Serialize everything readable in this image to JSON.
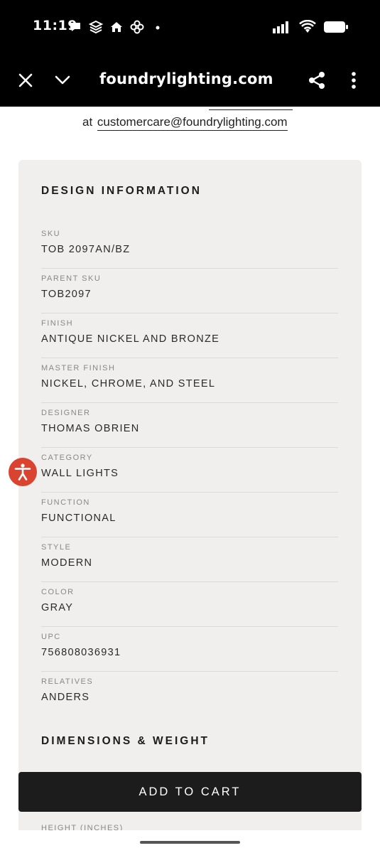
{
  "status_bar": {
    "time": "11:19",
    "left_icons": [
      "chat-bubble-icon",
      "layers-icon",
      "home-icon",
      "pinwheel-icon",
      "dot-icon"
    ],
    "right_icons": [
      "signal-icon",
      "wifi-icon",
      "battery-icon"
    ]
  },
  "browser": {
    "url": "foundrylighting.com",
    "icons": [
      "close-icon",
      "chevron-down-icon",
      "share-icon",
      "more-vert-icon"
    ]
  },
  "contact": {
    "prefix": "at",
    "email": "customercare@foundrylighting.com"
  },
  "design_info": {
    "title": "DESIGN INFORMATION",
    "items": [
      {
        "label": "SKU",
        "value": "TOB 2097AN/BZ"
      },
      {
        "label": "PARENT SKU",
        "value": "TOB2097"
      },
      {
        "label": "FINISH",
        "value": "ANTIQUE NICKEL AND BRONZE"
      },
      {
        "label": "MASTER FINISH",
        "value": "NICKEL, CHROME, AND STEEL"
      },
      {
        "label": "DESIGNER",
        "value": "THOMAS OBRIEN"
      },
      {
        "label": "CATEGORY",
        "value": "WALL LIGHTS"
      },
      {
        "label": "FUNCTION",
        "value": "FUNCTIONAL"
      },
      {
        "label": "STYLE",
        "value": "MODERN"
      },
      {
        "label": "COLOR",
        "value": "GRAY"
      },
      {
        "label": "UPC",
        "value": "756808036931"
      },
      {
        "label": "RELATIVES",
        "value": "ANDERS"
      }
    ]
  },
  "dimensions": {
    "title": "DIMENSIONS & WEIGHT",
    "first_label": "HEIGHT (INCHES)"
  },
  "cart": {
    "label": "ADD TO CART"
  },
  "accessibility": {
    "icon": "accessibility-icon",
    "color": "#d9432f"
  }
}
